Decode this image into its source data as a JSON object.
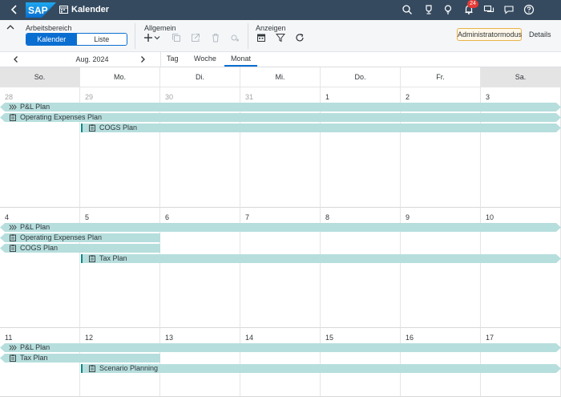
{
  "shell": {
    "logo": "SAP",
    "title": "Kalender",
    "notification_count": "24",
    "icons": [
      "back-icon",
      "calendar-icon",
      "search-icon",
      "trophy-icon",
      "lightbulb-icon",
      "bell-icon",
      "chat-icon",
      "feedback-icon",
      "help-icon"
    ]
  },
  "toolbar": {
    "workspace_label": "Arbeitsbereich",
    "seg_calendar": "Kalender",
    "seg_list": "Liste",
    "general_label": "Allgemein",
    "show_label": "Anzeigen",
    "admin_mode": "Administratormodus",
    "details": "Details"
  },
  "nav": {
    "month": "Aug. 2024",
    "tabs": [
      "Tag",
      "Woche",
      "Monat"
    ],
    "active_tab": "Monat"
  },
  "calendar": {
    "weekdays": [
      "So.",
      "Mo.",
      "Di.",
      "Mi.",
      "Do.",
      "Fr.",
      "Sa."
    ],
    "weeks": [
      {
        "days": [
          "28",
          "29",
          "30",
          "31",
          "1",
          "2",
          "3"
        ],
        "other_month": [
          true,
          true,
          true,
          true,
          false,
          false,
          false
        ],
        "events": [
          {
            "title": "P&L Plan",
            "icon": "chevrons-icon",
            "start": 0,
            "end": 7,
            "row": 0,
            "cont_left": true,
            "cont_right": true
          },
          {
            "title": "Operating Expenses Plan",
            "icon": "clipboard-icon",
            "start": 0,
            "end": 7,
            "row": 1,
            "cont_left": true,
            "cont_right": true
          },
          {
            "title": "COGS Plan",
            "icon": "clipboard-icon",
            "start": 1,
            "end": 7,
            "row": 2,
            "cont_left": false,
            "cont_right": true,
            "marker": true
          }
        ]
      },
      {
        "days": [
          "4",
          "5",
          "6",
          "7",
          "8",
          "9",
          "10"
        ],
        "other_month": [
          false,
          false,
          false,
          false,
          false,
          false,
          false
        ],
        "events": [
          {
            "title": "P&L Plan",
            "icon": "chevrons-icon",
            "start": 0,
            "end": 7,
            "row": 0,
            "cont_left": true,
            "cont_right": true
          },
          {
            "title": "Operating Expenses Plan",
            "icon": "clipboard-icon",
            "start": 0,
            "end": 2,
            "row": 1,
            "cont_left": true,
            "cont_right": false
          },
          {
            "title": "COGS Plan",
            "icon": "clipboard-icon",
            "start": 0,
            "end": 2,
            "row": 2,
            "cont_left": true,
            "cont_right": false
          },
          {
            "title": "Tax Plan",
            "icon": "clipboard-icon",
            "start": 1,
            "end": 7,
            "row": 3,
            "cont_left": false,
            "cont_right": true,
            "marker": true
          }
        ]
      },
      {
        "days": [
          "11",
          "12",
          "13",
          "14",
          "15",
          "16",
          "17"
        ],
        "other_month": [
          false,
          false,
          false,
          false,
          false,
          false,
          false
        ],
        "events": [
          {
            "title": "P&L Plan",
            "icon": "chevrons-icon",
            "start": 0,
            "end": 7,
            "row": 0,
            "cont_left": true,
            "cont_right": true
          },
          {
            "title": "Tax Plan",
            "icon": "clipboard-icon",
            "start": 0,
            "end": 2,
            "row": 1,
            "cont_left": true,
            "cont_right": false
          },
          {
            "title": "Scenario Planning",
            "icon": "clipboard-icon",
            "start": 1,
            "end": 7,
            "row": 2,
            "cont_left": false,
            "cont_right": true,
            "marker": true
          }
        ]
      }
    ]
  }
}
